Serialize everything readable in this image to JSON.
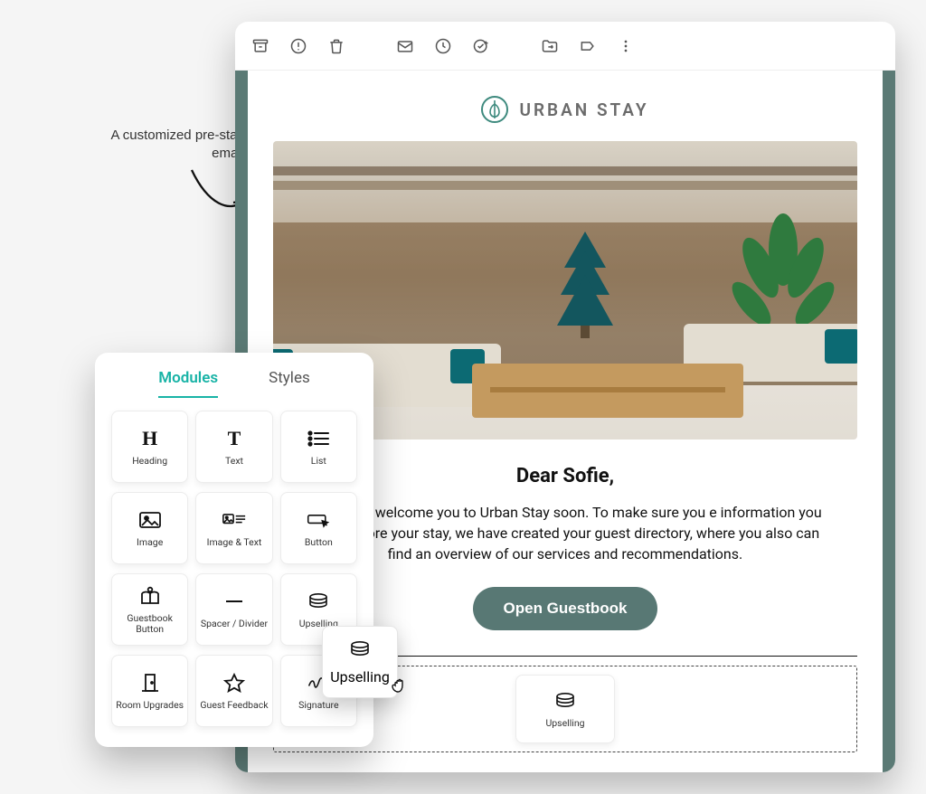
{
  "annotation": "A customized pre-stay email",
  "toolbar_icons": [
    "archive",
    "report-spam",
    "delete",
    "mark-unread",
    "snooze",
    "add-task",
    "move-to",
    "labels",
    "more"
  ],
  "brand": {
    "name": "URBAN STAY"
  },
  "email": {
    "greeting": "Dear Sofie,",
    "body_visible": "excited to welcome you to Urban Stay soon. To make sure you e information you need before your stay, we have created your guest directory, where you also can find an overview of our services and recommendations.",
    "cta": "Open Guestbook"
  },
  "panel": {
    "tabs": {
      "modules": "Modules",
      "styles": "Styles"
    },
    "active_tab": "modules",
    "modules": [
      {
        "id": "heading",
        "label": "Heading"
      },
      {
        "id": "text",
        "label": "Text"
      },
      {
        "id": "list",
        "label": "List"
      },
      {
        "id": "image",
        "label": "Image"
      },
      {
        "id": "image-text",
        "label": "Image & Text"
      },
      {
        "id": "button",
        "label": "Button"
      },
      {
        "id": "guestbook-button",
        "label": "Guestbook Button"
      },
      {
        "id": "spacer-divider",
        "label": "Spacer / Divider"
      },
      {
        "id": "upselling",
        "label": "Upselling"
      },
      {
        "id": "room-upgrades",
        "label": "Room Upgrades"
      },
      {
        "id": "guest-feedback",
        "label": "Guest Feedback"
      },
      {
        "id": "signature",
        "label": "Signature"
      }
    ]
  },
  "drag": {
    "label": "Upselling"
  },
  "dropzone": {
    "label": "Upselling"
  },
  "colors": {
    "accent": "#18b3a6",
    "brand": "#587874"
  }
}
